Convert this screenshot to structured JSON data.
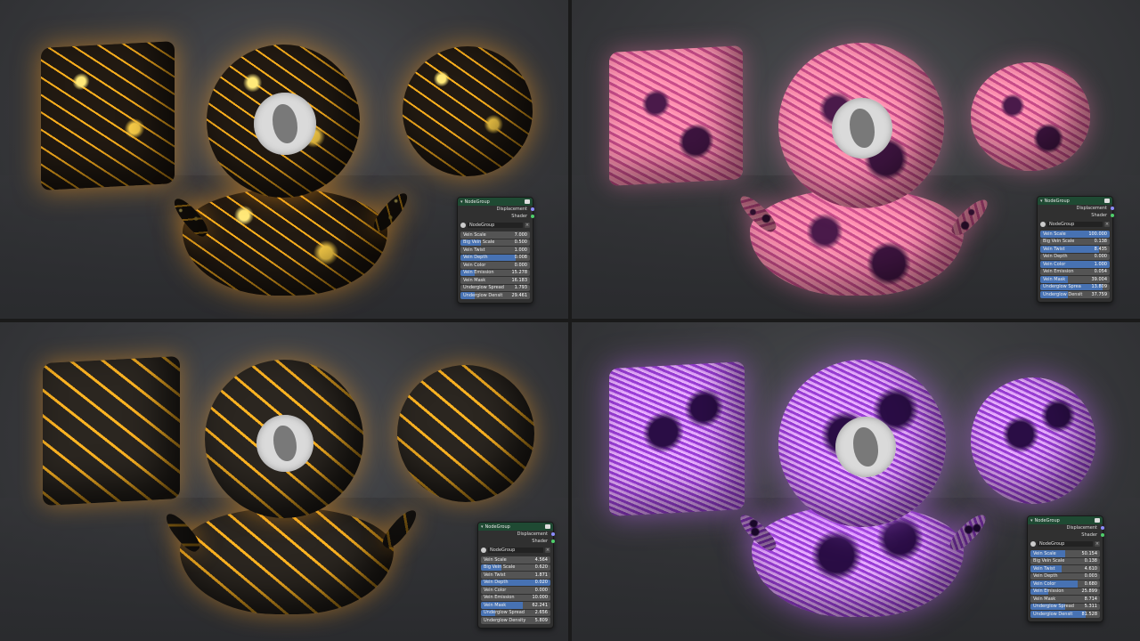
{
  "panels": [
    {
      "id": "top-left",
      "theme": "lava",
      "node": {
        "header": "NodeGroup",
        "outputs": [
          {
            "label": "Displacement",
            "color": "#8c8cff"
          },
          {
            "label": "Shader",
            "color": "#4fcf6b"
          }
        ],
        "group_name": "NodeGroup",
        "fields": [
          {
            "label": "Vein Scale",
            "value": "7.000",
            "active": false,
            "fill": 0.0
          },
          {
            "label": "Big Vein Scale",
            "value": "0.500",
            "active": true,
            "fill": 0.3
          },
          {
            "label": "Vein Twist",
            "value": "1.000",
            "active": false,
            "fill": 0.0
          },
          {
            "label": "Vein Depth",
            "value": "0.008",
            "active": true,
            "fill": 0.8
          },
          {
            "label": "Vein Color",
            "value": "0.000",
            "active": false,
            "fill": 0.0
          },
          {
            "label": "Vein Emission",
            "value": "15.278",
            "active": true,
            "fill": 0.2
          },
          {
            "label": "Vein Mask",
            "value": "16.183",
            "active": false,
            "fill": 0.0
          },
          {
            "label": "Underglow Spread",
            "value": "1.793",
            "active": false,
            "fill": 0.0
          },
          {
            "label": "Underglow Densit",
            "value": "29.461",
            "active": true,
            "fill": 0.2
          }
        ]
      }
    },
    {
      "id": "top-right",
      "theme": "pink",
      "node": {
        "header": "NodeGroup",
        "outputs": [
          {
            "label": "Displacement",
            "color": "#8c8cff"
          },
          {
            "label": "Shader",
            "color": "#4fcf6b"
          }
        ],
        "group_name": "NodeGroup",
        "fields": [
          {
            "label": "Vein Scale",
            "value": "100.000",
            "active": true,
            "fill": 1.0
          },
          {
            "label": "Big Vein Scale",
            "value": "0.138",
            "active": false,
            "fill": 0.0
          },
          {
            "label": "Vein Twist",
            "value": "8.435",
            "active": true,
            "fill": 0.85
          },
          {
            "label": "Vein Depth",
            "value": "0.000",
            "active": false,
            "fill": 0.0
          },
          {
            "label": "Vein Color",
            "value": "1.000",
            "active": true,
            "fill": 1.0
          },
          {
            "label": "Vein Emission",
            "value": "0.054",
            "active": false,
            "fill": 0.0
          },
          {
            "label": "Vein Mask",
            "value": "39.004",
            "active": true,
            "fill": 0.4
          },
          {
            "label": "Underglow Sprea",
            "value": "13.809",
            "active": true,
            "fill": 0.9
          },
          {
            "label": "Underglow Densit",
            "value": "37.759",
            "active": true,
            "fill": 0.4
          }
        ]
      }
    },
    {
      "id": "bottom-left",
      "theme": "lava-dark",
      "node": {
        "header": "NodeGroup",
        "outputs": [
          {
            "label": "Displacement",
            "color": "#8c8cff"
          },
          {
            "label": "Shader",
            "color": "#4fcf6b"
          }
        ],
        "group_name": "NodeGroup",
        "fields": [
          {
            "label": "Vein Scale",
            "value": "4.564",
            "active": false,
            "fill": 0.0
          },
          {
            "label": "Big Vein Scale",
            "value": "0.620",
            "active": true,
            "fill": 0.3
          },
          {
            "label": "Vein Twist",
            "value": "1.871",
            "active": false,
            "fill": 0.0
          },
          {
            "label": "Vein Depth",
            "value": "0.020",
            "active": true,
            "fill": 1.0
          },
          {
            "label": "Vein Color",
            "value": "0.000",
            "active": false,
            "fill": 0.0
          },
          {
            "label": "Vein Emission",
            "value": "10.000",
            "active": false,
            "fill": 0.0
          },
          {
            "label": "Vein Mask",
            "value": "62.241",
            "active": true,
            "fill": 0.6
          },
          {
            "label": "Underglow Spread",
            "value": "2.656",
            "active": true,
            "fill": 0.2
          },
          {
            "label": "Underglow Density",
            "value": "5.809",
            "active": false,
            "fill": 0.0
          }
        ]
      }
    },
    {
      "id": "bottom-right",
      "theme": "purple",
      "node": {
        "header": "NodeGroup",
        "outputs": [
          {
            "label": "Displacement",
            "color": "#8c8cff"
          },
          {
            "label": "Shader",
            "color": "#4fcf6b"
          }
        ],
        "group_name": "NodeGroup",
        "fields": [
          {
            "label": "Vein Scale",
            "value": "50.154",
            "active": true,
            "fill": 0.5
          },
          {
            "label": "Big Vein Scale",
            "value": "0.138",
            "active": false,
            "fill": 0.0
          },
          {
            "label": "Vein Twist",
            "value": "4.610",
            "active": true,
            "fill": 0.45
          },
          {
            "label": "Vein Depth",
            "value": "0.003",
            "active": false,
            "fill": 0.0
          },
          {
            "label": "Vein Color",
            "value": "0.680",
            "active": true,
            "fill": 0.68
          },
          {
            "label": "Vein Emission",
            "value": "25.899",
            "active": true,
            "fill": 0.25
          },
          {
            "label": "Vein Mask",
            "value": "8.714",
            "active": false,
            "fill": 0.0
          },
          {
            "label": "Underglow Spread",
            "value": "5.311",
            "active": true,
            "fill": 0.5
          },
          {
            "label": "Underglow Densit",
            "value": "81.528",
            "active": true,
            "fill": 0.8
          }
        ]
      }
    }
  ]
}
